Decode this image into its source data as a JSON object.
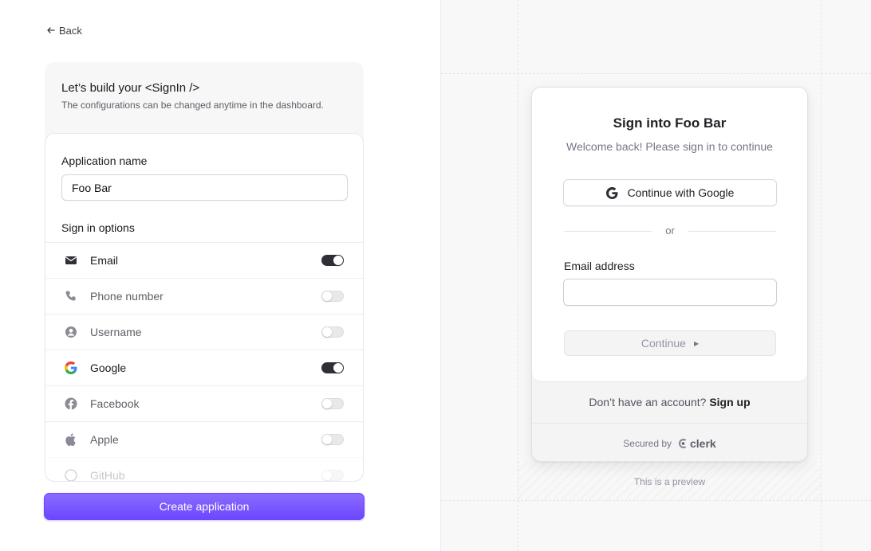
{
  "nav": {
    "back_label": "Back"
  },
  "config": {
    "title": "Let’s build your <SignIn />",
    "subtitle": "The configurations can be changed anytime in the dashboard.",
    "app_name_label": "Application name",
    "app_name_value": "Foo Bar",
    "sign_in_options_label": "Sign in options",
    "options": [
      {
        "label": "Email",
        "icon": "mail-icon",
        "enabled": true
      },
      {
        "label": "Phone number",
        "icon": "phone-icon",
        "enabled": false
      },
      {
        "label": "Username",
        "icon": "user-circle-icon",
        "enabled": false
      },
      {
        "label": "Google",
        "icon": "google-icon",
        "enabled": true
      },
      {
        "label": "Facebook",
        "icon": "facebook-icon",
        "enabled": false
      },
      {
        "label": "Apple",
        "icon": "apple-icon",
        "enabled": false
      },
      {
        "label": "GitHub",
        "icon": "github-icon",
        "enabled": false
      }
    ],
    "create_button_label": "Create application"
  },
  "preview": {
    "title": "Sign into Foo Bar",
    "subtitle": "Welcome back! Please sign in to continue",
    "google_button_label": "Continue with Google",
    "divider_text": "or",
    "email_label": "Email address",
    "email_value": "",
    "continue_label": "Continue",
    "signup_prompt": "Don’t have an account?",
    "signup_link": "Sign up",
    "secured_by": "Secured by",
    "brand": "clerk",
    "preview_note": "This is a preview"
  },
  "colors": {
    "accent": "#6c47ff",
    "toggle_on": "#2f3037",
    "google_blue": "#4285F4",
    "google_red": "#EA4335",
    "google_yellow": "#FBBC05",
    "google_green": "#34A853"
  }
}
